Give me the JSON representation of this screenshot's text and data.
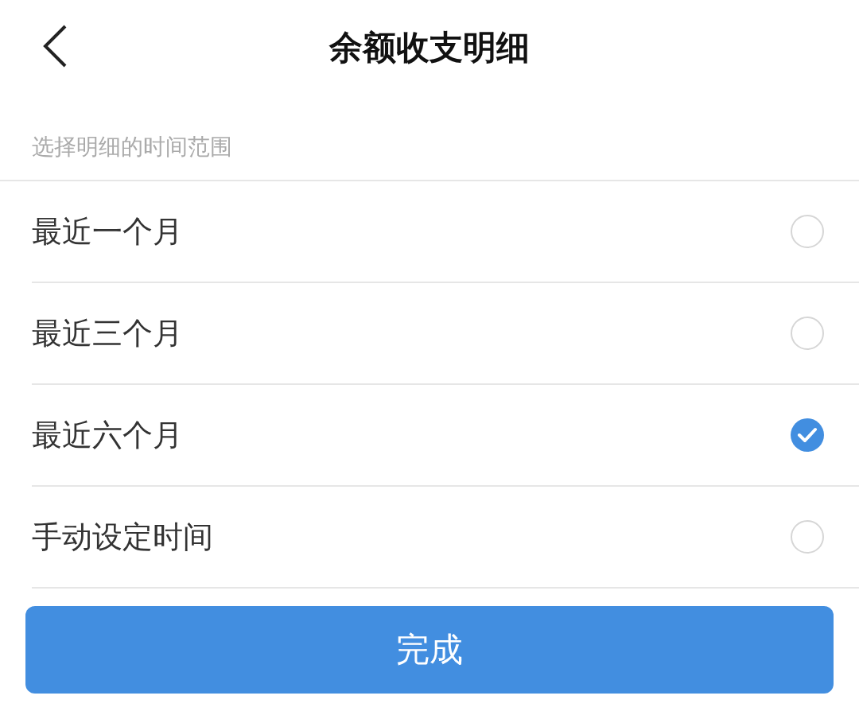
{
  "header": {
    "title": "余额收支明细"
  },
  "section": {
    "caption": "选择明细的时间范围"
  },
  "options": [
    {
      "label": "最近一个月",
      "selected": false
    },
    {
      "label": "最近三个月",
      "selected": false
    },
    {
      "label": "最近六个月",
      "selected": true
    },
    {
      "label": "手动设定时间",
      "selected": false
    }
  ],
  "button": {
    "label": "完成"
  }
}
